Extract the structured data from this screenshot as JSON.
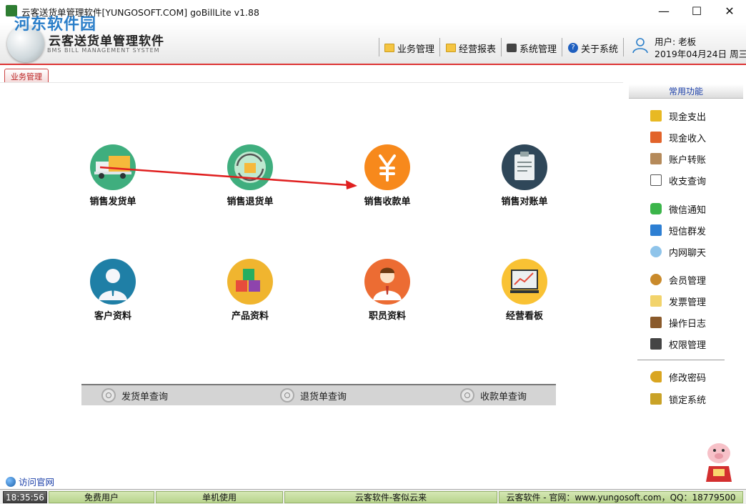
{
  "window": {
    "title": "云客送货单管理软件[YUNGOSOFT.COM]  goBillLite v1.88",
    "watermark": "河东软件园",
    "controls": {
      "minimize": "—",
      "maximize": "☐",
      "close": "✕"
    }
  },
  "header": {
    "logo_title": "云客送货单管理软件",
    "logo_subtitle": "BMS BILL MANAGEMENT SYSTEM",
    "menu": [
      {
        "label": "业务管理",
        "icon": "folder-icon"
      },
      {
        "label": "经营报表",
        "icon": "folder-icon"
      },
      {
        "label": "系统管理",
        "icon": "settings-icon"
      },
      {
        "label": "关于系统",
        "icon": "help-icon"
      }
    ],
    "user_label": "用户: 老板",
    "date_label": "2019年04月24日 周三"
  },
  "tab": {
    "label": "业务管理"
  },
  "tiles": [
    {
      "label": "销售发货单",
      "icon": "truck-icon",
      "color": "#3fae7e"
    },
    {
      "label": "销售退货单",
      "icon": "return-cycle-icon",
      "color": "#3fae7e"
    },
    {
      "label": "销售收款单",
      "icon": "yuan-icon",
      "color": "#f7891c"
    },
    {
      "label": "销售对账单",
      "icon": "clipboard-icon",
      "color": "#2f4759"
    },
    {
      "label": "客户资料",
      "icon": "customer-icon",
      "color": "#1f7fa6"
    },
    {
      "label": "产品资料",
      "icon": "boxes-icon",
      "color": "#f0b52f"
    },
    {
      "label": "职员资料",
      "icon": "employee-icon",
      "color": "#ec6c33"
    },
    {
      "label": "经营看板",
      "icon": "dashboard-icon",
      "color": "#f9c234"
    }
  ],
  "query_bar": [
    {
      "label": "发货单查询"
    },
    {
      "label": "退货单查询"
    },
    {
      "label": "收款单查询"
    }
  ],
  "sidebar": {
    "title": "常用功能",
    "items": [
      {
        "label": "现金支出",
        "icon": "cash-out-icon",
        "color": "#e8b923"
      },
      {
        "label": "现金收入",
        "icon": "cash-in-icon",
        "color": "#e2632a"
      },
      {
        "label": "账户转账",
        "icon": "signpost-icon",
        "color": "#b58a5a"
      },
      {
        "label": "收支查询",
        "icon": "search-doc-icon",
        "color": "#555555"
      },
      {
        "label": "微信通知",
        "icon": "wechat-icon",
        "color": "#3bb54a"
      },
      {
        "label": "短信群发",
        "icon": "sms-icon",
        "color": "#2d7fd3"
      },
      {
        "label": "内网聊天",
        "icon": "chat-bubble-icon",
        "color": "#8fc4ea"
      },
      {
        "label": "会员管理",
        "icon": "medal-icon",
        "color": "#c98a2b"
      },
      {
        "label": "发票管理",
        "icon": "note-icon",
        "color": "#f2d36b"
      },
      {
        "label": "操作日志",
        "icon": "log-book-icon",
        "color": "#8a5a2b"
      },
      {
        "label": "权限管理",
        "icon": "monitor-icon",
        "color": "#444444"
      },
      {
        "label": "修改密码",
        "icon": "key-icon",
        "color": "#d9a520"
      },
      {
        "label": "锁定系统",
        "icon": "lock-icon",
        "color": "#c9a227"
      }
    ]
  },
  "visit_link": "访问官网",
  "status_bar": {
    "time": "18:35:56",
    "user_type": "免费用户",
    "mode": "单机使用",
    "slogan": "云客软件-客似云来",
    "contact": "云客软件 - 官网：www.yungosoft.com，QQ：18779500"
  },
  "accent_color": "#d33333"
}
